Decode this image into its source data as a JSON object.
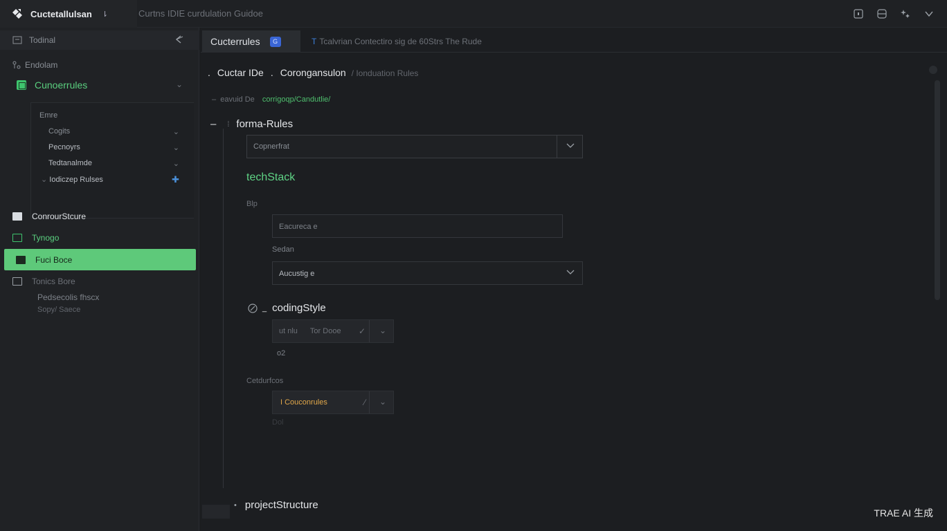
{
  "app": {
    "name": "Cuctetallulsan",
    "window_title": "Curtns IDIE curdulation Guidoe"
  },
  "sidebar": {
    "top_label": "Todinal",
    "section_title": "Endolam",
    "active_folder": "Cunoerrules",
    "subitems": [
      {
        "label": "Emre"
      },
      {
        "label": "Cogits"
      },
      {
        "label": "Pecnoyrs"
      },
      {
        "label": "Tedtanalmde"
      },
      {
        "label": "Iodiczep Rulses"
      }
    ],
    "items": [
      {
        "label": "ConrourStcure"
      },
      {
        "label": "Tynogo"
      },
      {
        "label": "Fuci Boce"
      },
      {
        "label": "Tonics Bore"
      }
    ],
    "footer_lines": [
      "Pedsecolis fhscx",
      "Sopy/ Saece"
    ]
  },
  "tabs": [
    {
      "label": "Cucterrules",
      "badge": "G"
    },
    {
      "label": "Tcalvrian Contectiro sig de 60Strs  The Rude",
      "marker": "T"
    }
  ],
  "breadcrumb": {
    "part1": "Cuctar IDe",
    "part2": "Corongansulon",
    "muted": "/ Ionduation Rules"
  },
  "saved_line": {
    "label": "eavuid De",
    "path": "corrigoqp/Candutlie/"
  },
  "sections": {
    "forma": {
      "title": "forma-Rules",
      "select_value": "Copnerfrat"
    },
    "techStack": {
      "title": "techStack",
      "label1": "Blp",
      "input1": "Eacureca e",
      "label2": "Sedan",
      "select2": "Aucustig e"
    },
    "codingStyle": {
      "title": "codingStyle",
      "row1_t1": "ut nlu",
      "row1_t2": "Tor Dooe",
      "label": "o2",
      "label2": "Cetdurfcos",
      "row2_text": "I Couconrules",
      "trailing": "Dol"
    },
    "projectStructure": {
      "title": "projectStructure"
    }
  },
  "watermark": "TRAE AI 生成",
  "colors": {
    "accent_green": "#5ec97a",
    "tab_badge_blue": "#3a66d6",
    "orange": "#e2a84a"
  }
}
